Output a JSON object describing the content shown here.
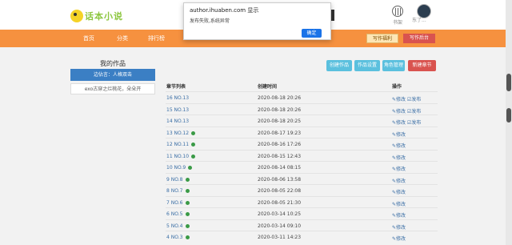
{
  "header": {
    "logo_text": "话本小说",
    "shelf_label": "书架",
    "user_name": "东了..."
  },
  "nav": {
    "items": [
      "首页",
      "分类",
      "排行榜"
    ],
    "write_help": "写作福利",
    "admin": "写作后台"
  },
  "sidebar": {
    "title": "我的作品",
    "active_label": "边佔言：人格双击",
    "work": "exo古穿之烂桃花，朵朵开"
  },
  "actions": {
    "create_work": "创建作品",
    "work_settings": "作品设置",
    "role_manage": "角色管理",
    "new_chapter": "新建章节"
  },
  "table": {
    "headers": [
      "章节列表",
      "创建时间",
      "操作"
    ],
    "rows": [
      {
        "title": "16 NO.13",
        "date": "2020-08-18 20:26",
        "ops": "✎修改 ☑发布",
        "checked": false
      },
      {
        "title": "15 NO.13",
        "date": "2020-08-18 20:26",
        "ops": "✎修改 ☑发布",
        "checked": false
      },
      {
        "title": "14 NO.13",
        "date": "2020-08-18 20:25",
        "ops": "✎修改 ☑发布",
        "checked": false
      },
      {
        "title": "13 NO.12",
        "date": "2020-08-17 19:23",
        "ops": "✎修改",
        "checked": true
      },
      {
        "title": "12 NO.11",
        "date": "2020-08-16 17:26",
        "ops": "✎修改",
        "checked": true
      },
      {
        "title": "11 NO.10",
        "date": "2020-08-15 12:43",
        "ops": "✎修改",
        "checked": true
      },
      {
        "title": "10 NO.9",
        "date": "2020-08-14 08:15",
        "ops": "✎修改",
        "checked": true
      },
      {
        "title": "9 NO.8",
        "date": "2020-08-06 13:58",
        "ops": "✎修改",
        "checked": true
      },
      {
        "title": "8 NO.7",
        "date": "2020-08-05 22:08",
        "ops": "✎修改",
        "checked": true
      },
      {
        "title": "7 NO.6",
        "date": "2020-08-05 21:30",
        "ops": "✎修改",
        "checked": true
      },
      {
        "title": "6 NO.5",
        "date": "2020-03-14 10:25",
        "ops": "✎修改",
        "checked": true
      },
      {
        "title": "5 NO.4",
        "date": "2020-03-14 09:10",
        "ops": "✎修改",
        "checked": true
      },
      {
        "title": "4 NO.3",
        "date": "2020-03-11 14:23",
        "ops": "✎修改",
        "checked": true
      }
    ]
  },
  "dialog": {
    "title": "author.ihuaben.com 显示",
    "message": "发布失败,系统异常",
    "ok_label": "确定"
  },
  "colors": {
    "nav_bg": "#f6913f",
    "active_blue": "#3b7fc4",
    "create_btn": "#5bc0de",
    "settings_btn": "#5bc0de",
    "role_btn": "#5bc0de",
    "new_chapter_btn": "#d9534f",
    "check_green": "#3a9a46"
  }
}
